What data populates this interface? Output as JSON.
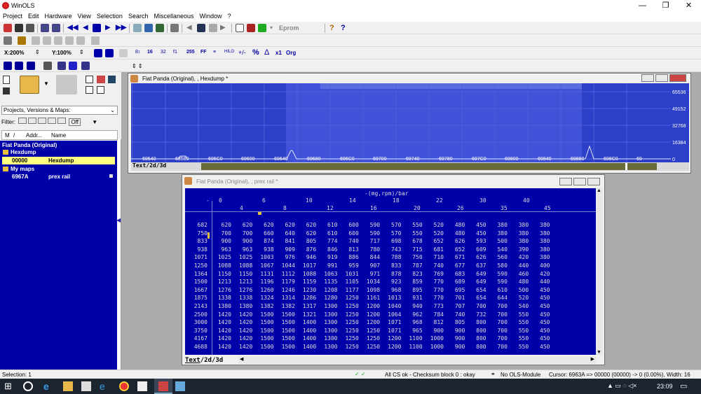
{
  "app": {
    "title": "WinOLS"
  },
  "menu": [
    "Project",
    "Edit",
    "Hardware",
    "View",
    "Selection",
    "Search",
    "Miscellaneous",
    "Window",
    "?"
  ],
  "toolbar": {
    "eprom_label": "Eprom",
    "xzoom": "X:200%",
    "yzoom": "Y:100%",
    "bits": "16",
    "format_label": "255",
    "ff_label": "FF",
    "org_label": "Org",
    "x1_label": "x1",
    "percent_label": "%"
  },
  "left": {
    "projects_select": "Projects, Versions & Maps:",
    "filter_label": "Filter:",
    "filter_off": "Off",
    "tree_headers": [
      "M",
      "/",
      "Addr...",
      "Name"
    ],
    "tree": [
      {
        "addr": "",
        "name": "Fiat Panda (Original)"
      },
      {
        "addr": "",
        "name": "Hexdump"
      },
      {
        "addr": "00000",
        "name": "Hexdump"
      },
      {
        "addr": "",
        "name": "My maps"
      },
      {
        "addr": "6967A",
        "name": "prex rail"
      }
    ]
  },
  "hexwin": {
    "title": "Fiat Panda (Original), , Hexdump *",
    "yticks": [
      "65536",
      "49152",
      "32768",
      "16384",
      "0"
    ],
    "xticks": [
      "69540",
      "69580",
      "695C0",
      "69600",
      "69640",
      "69680",
      "696C0",
      "69700",
      "69740",
      "69780",
      "697C0",
      "69800",
      "69840",
      "69880",
      "698C0",
      "69"
    ],
    "tabs": [
      "Text",
      "2d",
      "3d"
    ]
  },
  "mapwin": {
    "title": "Fiat Panda (Original), , prex rail *",
    "axis_label": "-(mg,rpm)/bar",
    "col_top": [
      "0",
      "6",
      "10",
      "14",
      "18",
      "22",
      "30",
      "40"
    ],
    "col_bottom": [
      "4",
      "8",
      "12",
      "16",
      "20",
      "26",
      "35",
      "45"
    ],
    "row_headers": [
      "682",
      "750",
      "833",
      "938",
      "1071",
      "1250",
      "1364",
      "1500",
      "1667",
      "1875",
      "2143",
      "2500",
      "3000",
      "3750",
      "4167",
      "4688"
    ],
    "rows": [
      [
        "620",
        "620",
        "620",
        "620",
        "620",
        "610",
        "600",
        "590",
        "570",
        "550",
        "520",
        "480",
        "450",
        "380",
        "380",
        "380"
      ],
      [
        "700",
        "700",
        "660",
        "640",
        "620",
        "610",
        "600",
        "590",
        "570",
        "550",
        "520",
        "480",
        "450",
        "380",
        "380",
        "380"
      ],
      [
        "900",
        "900",
        "874",
        "841",
        "805",
        "774",
        "740",
        "717",
        "698",
        "678",
        "652",
        "626",
        "593",
        "500",
        "380",
        "380"
      ],
      [
        "963",
        "963",
        "938",
        "909",
        "876",
        "846",
        "813",
        "780",
        "743",
        "715",
        "681",
        "652",
        "609",
        "540",
        "390",
        "380"
      ],
      [
        "1025",
        "1025",
        "1003",
        "976",
        "946",
        "919",
        "886",
        "844",
        "788",
        "750",
        "710",
        "671",
        "626",
        "560",
        "420",
        "380"
      ],
      [
        "1088",
        "1088",
        "1067",
        "1044",
        "1017",
        "991",
        "959",
        "907",
        "833",
        "787",
        "740",
        "677",
        "637",
        "580",
        "440",
        "400"
      ],
      [
        "1150",
        "1150",
        "1131",
        "1112",
        "1088",
        "1063",
        "1031",
        "971",
        "878",
        "823",
        "769",
        "683",
        "649",
        "590",
        "460",
        "420"
      ],
      [
        "1213",
        "1213",
        "1196",
        "1179",
        "1159",
        "1135",
        "1105",
        "1034",
        "923",
        "859",
        "770",
        "689",
        "649",
        "590",
        "480",
        "440"
      ],
      [
        "1276",
        "1276",
        "1260",
        "1246",
        "1230",
        "1208",
        "1177",
        "1098",
        "968",
        "895",
        "770",
        "695",
        "654",
        "610",
        "500",
        "450"
      ],
      [
        "1338",
        "1338",
        "1324",
        "1314",
        "1286",
        "1280",
        "1250",
        "1161",
        "1013",
        "931",
        "770",
        "701",
        "654",
        "644",
        "520",
        "450"
      ],
      [
        "1380",
        "1380",
        "1382",
        "1382",
        "1317",
        "1300",
        "1250",
        "1200",
        "1040",
        "940",
        "773",
        "707",
        "700",
        "700",
        "540",
        "450"
      ],
      [
        "1420",
        "1420",
        "1500",
        "1500",
        "1321",
        "1300",
        "1250",
        "1200",
        "1064",
        "962",
        "784",
        "740",
        "732",
        "700",
        "550",
        "450"
      ],
      [
        "1420",
        "1420",
        "1500",
        "1500",
        "1400",
        "1300",
        "1250",
        "1200",
        "1071",
        "968",
        "812",
        "805",
        "800",
        "700",
        "550",
        "450"
      ],
      [
        "1420",
        "1420",
        "1500",
        "1500",
        "1400",
        "1300",
        "1250",
        "1250",
        "1071",
        "965",
        "900",
        "900",
        "800",
        "700",
        "550",
        "450"
      ],
      [
        "1420",
        "1420",
        "1500",
        "1500",
        "1400",
        "1300",
        "1250",
        "1250",
        "1200",
        "1100",
        "1000",
        "900",
        "800",
        "700",
        "550",
        "450"
      ],
      [
        "1420",
        "1420",
        "1500",
        "1500",
        "1400",
        "1300",
        "1250",
        "1250",
        "1200",
        "1100",
        "1000",
        "900",
        "800",
        "700",
        "550",
        "450"
      ]
    ],
    "tabs": [
      "Text",
      "2d",
      "3d"
    ]
  },
  "status": {
    "selection": "Selection: 1",
    "checksum": "All CS ok - Checksum block 0 : okay",
    "ols": "No OLS-Module",
    "cursor": "Cursor: 6963A => 00000 (00000) -> 0 (0.00%), Width: 16"
  },
  "taskbar": {
    "time": "23:09"
  }
}
